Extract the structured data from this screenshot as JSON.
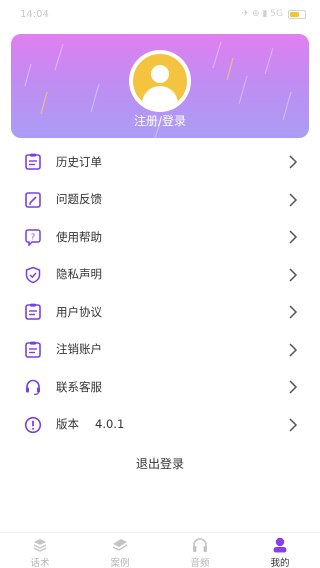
{
  "status_bar": {
    "time": "14:04",
    "indicators": "✈ ⊕ ▮ 5G",
    "battery_level": 0.55
  },
  "profile": {
    "avatar_icon": "user-avatar-icon",
    "login_label": "注册/登录"
  },
  "menu": {
    "items": [
      {
        "label": "历史订单",
        "icon": "order-history-icon"
      },
      {
        "label": "问题反馈",
        "icon": "feedback-icon"
      },
      {
        "label": "使用帮助",
        "icon": "help-icon"
      },
      {
        "label": "隐私声明",
        "icon": "privacy-shield-icon"
      },
      {
        "label": "用户协议",
        "icon": "agreement-icon"
      },
      {
        "label": "注销账户",
        "icon": "cancel-account-icon"
      },
      {
        "label": "联系客服",
        "icon": "headset-icon"
      },
      {
        "label": "版本",
        "icon": "info-icon",
        "value": "4.0.1"
      }
    ]
  },
  "logout_label": "退出登录",
  "tabbar": {
    "tabs": [
      {
        "label": "话术",
        "icon": "script-icon",
        "active": false
      },
      {
        "label": "案例",
        "icon": "case-icon",
        "active": false
      },
      {
        "label": "音频",
        "icon": "headphones-icon",
        "active": false
      },
      {
        "label": "我的",
        "icon": "profile-icon",
        "active": true
      }
    ]
  },
  "colors": {
    "accent": "#7b3fe4",
    "card_gradient_top": "#e07ff0",
    "card_gradient_bottom": "#a99df5",
    "avatar_yellow": "#f4c33f"
  }
}
